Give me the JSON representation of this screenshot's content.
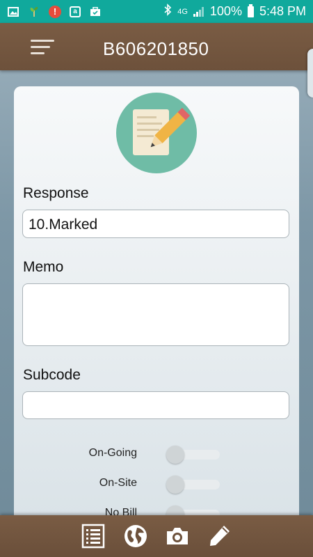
{
  "status_bar": {
    "battery_percent": "100%",
    "time": "5:48 PM",
    "network": "4G",
    "icons": [
      "image-icon",
      "plant-icon",
      "alert-icon",
      "amazon-icon",
      "briefcase-icon",
      "bluetooth-icon",
      "signal-icon",
      "battery-icon"
    ]
  },
  "app_bar": {
    "title": "B606201850",
    "menu_icon": "menu-icon"
  },
  "form": {
    "header_icon": "memo-pencil-icon",
    "response": {
      "label": "Response",
      "value": "10.Marked"
    },
    "memo": {
      "label": "Memo",
      "value": ""
    },
    "subcode": {
      "label": "Subcode",
      "value": ""
    },
    "toggles": [
      {
        "label": "On-Going",
        "on": false
      },
      {
        "label": "On-Site",
        "on": false
      },
      {
        "label": "No Bill",
        "on": false
      }
    ]
  },
  "bottom_bar": {
    "buttons": [
      "list-icon",
      "globe-icon",
      "camera-icon",
      "pencil-icon"
    ]
  },
  "colors": {
    "status_bar": "#10a99c",
    "app_bar": "#765840",
    "avatar_bg": "#6fbca6"
  }
}
